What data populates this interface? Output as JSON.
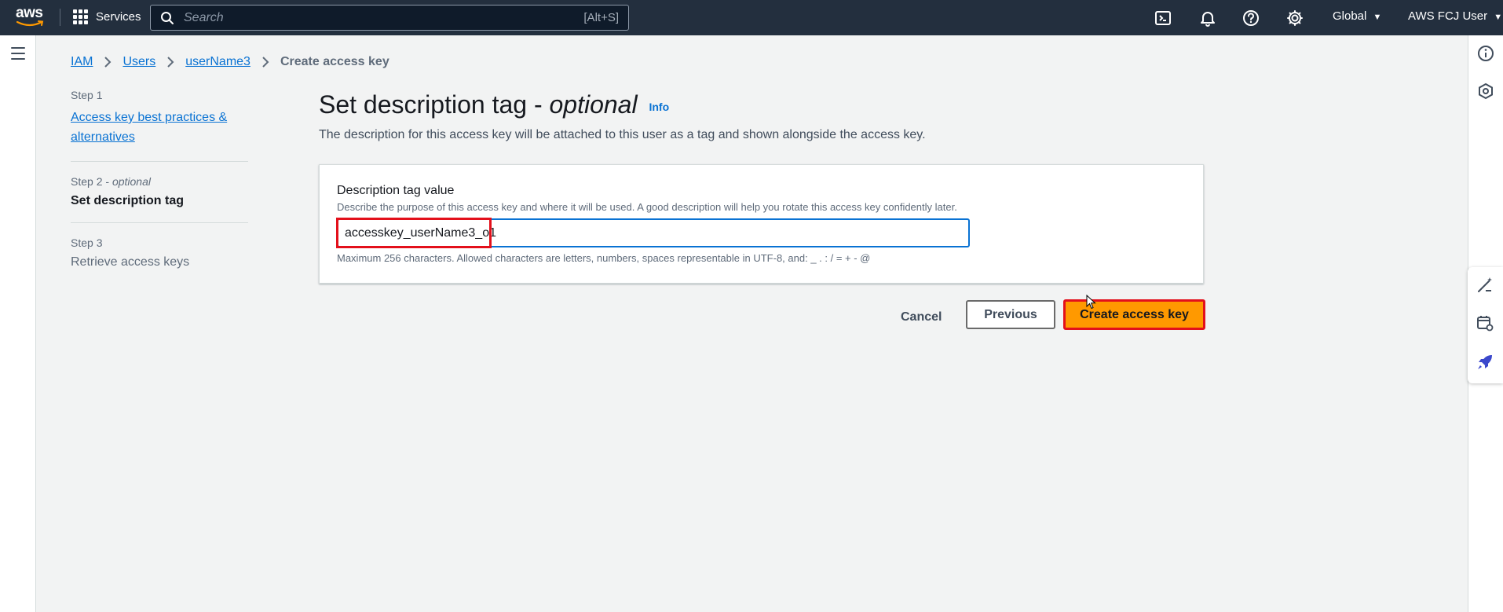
{
  "topnav": {
    "logo_text": "aws",
    "services_label": "Services",
    "search_placeholder": "Search",
    "search_shortcut": "[Alt+S]",
    "region_label": "Global",
    "account_label": "AWS FCJ User"
  },
  "breadcrumb": {
    "items": [
      "IAM",
      "Users",
      "userName3"
    ],
    "current": "Create access key"
  },
  "steps": [
    {
      "number": "Step 1",
      "label": "Access key best practices & alternatives"
    },
    {
      "number": "Step 2",
      "number_suffix": "optional",
      "label": "Set description tag"
    },
    {
      "number": "Step 3",
      "label": "Retrieve access keys"
    }
  ],
  "page": {
    "title": "Set description tag -",
    "title_italic": "optional",
    "info_link": "Info",
    "description": "The description for this access key will be attached to this user as a tag and shown alongside the access key."
  },
  "form": {
    "label": "Description tag value",
    "description": "Describe the purpose of this access key and where it will be used. A good description will help you rotate this access key confidently later.",
    "value": "accesskey_userName3_o1",
    "constraint": "Maximum 256 characters. Allowed characters are letters, numbers, spaces representable in UTF-8, and: _ . : / = + - @"
  },
  "actions": {
    "cancel": "Cancel",
    "previous": "Previous",
    "create": "Create access key"
  },
  "colors": {
    "nav_bg": "#232f3e",
    "link": "#0972d3",
    "primary": "#ff9900",
    "highlight": "#e3101b"
  }
}
